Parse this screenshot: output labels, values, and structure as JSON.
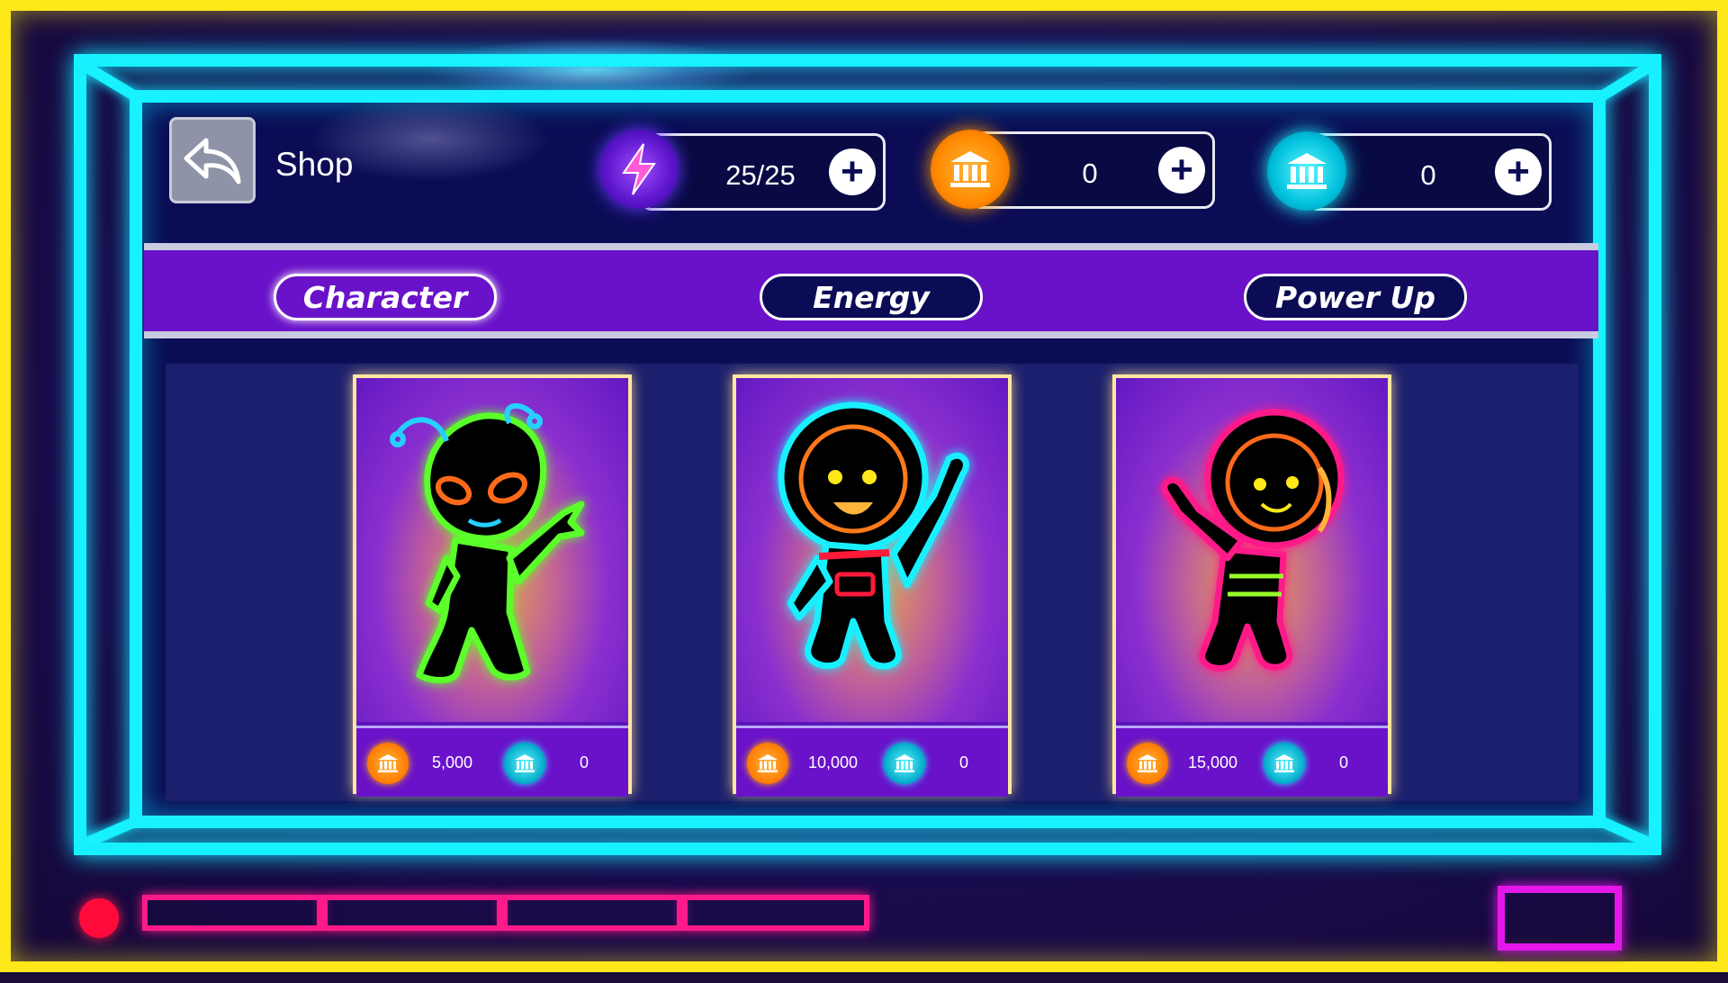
{
  "header": {
    "title": "Shop",
    "back_icon": "back-arrow-icon"
  },
  "resources": {
    "energy": {
      "icon": "lightning-icon",
      "value": "25/25"
    },
    "gold": {
      "icon": "bank-icon",
      "value": "0"
    },
    "gems": {
      "icon": "bank-icon",
      "value": "0"
    }
  },
  "tabs": [
    {
      "label": "Character",
      "active": true
    },
    {
      "label": "Energy",
      "active": false
    },
    {
      "label": "Power Up",
      "active": false
    }
  ],
  "cards": [
    {
      "character": "alien",
      "gold_price": "5,000",
      "gem_price": "0"
    },
    {
      "character": "astronaut-boy",
      "gold_price": "10,000",
      "gem_price": "0"
    },
    {
      "character": "astronaut-girl",
      "gold_price": "15,000",
      "gem_price": "0"
    }
  ],
  "colors": {
    "neon_cyan": "#18f2ff",
    "neon_yellow": "#ffe81a",
    "purple": "#6a12c9",
    "navy": "#0b0c55",
    "gold": "#ff9a00",
    "pink": "#ff1a8a"
  }
}
